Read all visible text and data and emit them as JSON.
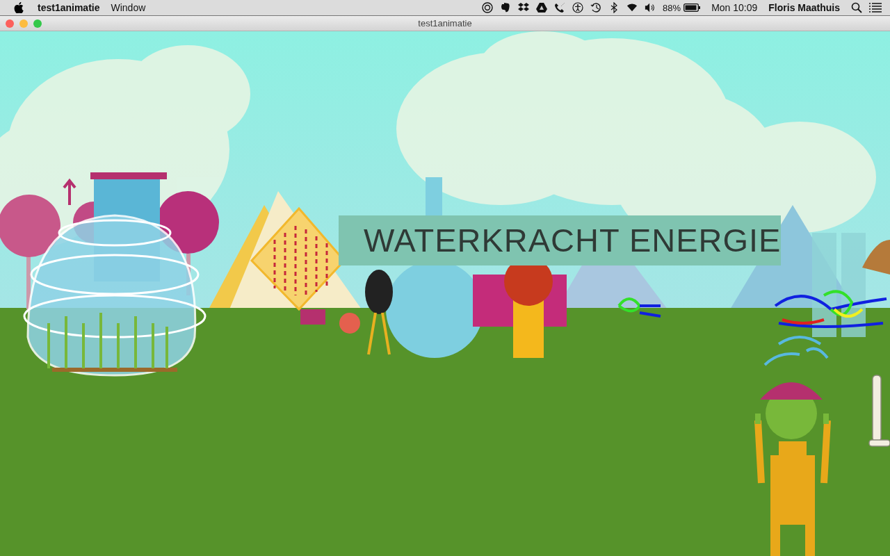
{
  "menu_bar": {
    "app_name": "test1animatie",
    "menus": [
      "Window"
    ],
    "battery_percent": "88%",
    "clock": "Mon 10:09",
    "user": "Floris Maathuis"
  },
  "window": {
    "title": "test1animatie"
  },
  "scene": {
    "banner": "WATERKRACHT ENERGIE"
  }
}
